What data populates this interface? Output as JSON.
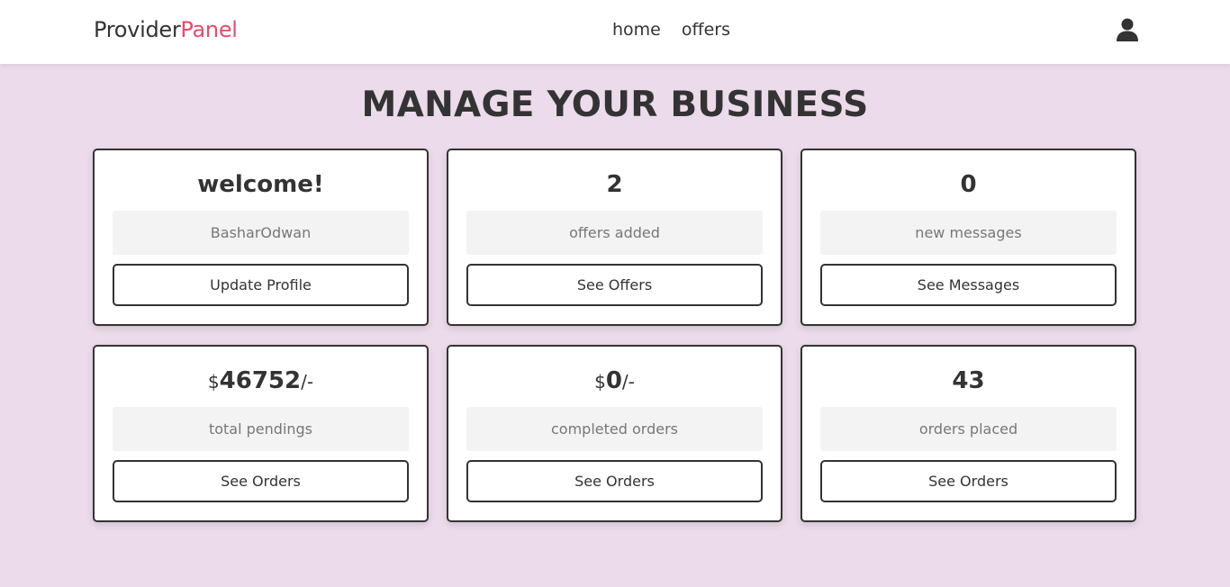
{
  "header": {
    "logo_main": "Provider",
    "logo_accent": "Panel",
    "nav": [
      "home",
      "offers"
    ],
    "user_icon": "user-icon"
  },
  "main": {
    "title": "MANAGE YOUR BUSINESS",
    "cards": [
      {
        "value": "welcome!",
        "label": "BasharOdwan",
        "button": "Update Profile"
      },
      {
        "value": "2",
        "label": "offers added",
        "button": "See Offers"
      },
      {
        "value": "0",
        "label": "new messages",
        "button": "See Messages"
      },
      {
        "currency": "$",
        "value": "46752",
        "suffix": "/-",
        "label": "total pendings",
        "button": "See Orders"
      },
      {
        "currency": "$",
        "value": "0",
        "suffix": "/-",
        "label": "completed orders",
        "button": "See Orders"
      },
      {
        "value": "43",
        "label": "orders placed",
        "button": "See Orders"
      }
    ]
  },
  "colors": {
    "background": "#ecdbea",
    "accent": "#e84a6b",
    "text": "#333333"
  }
}
